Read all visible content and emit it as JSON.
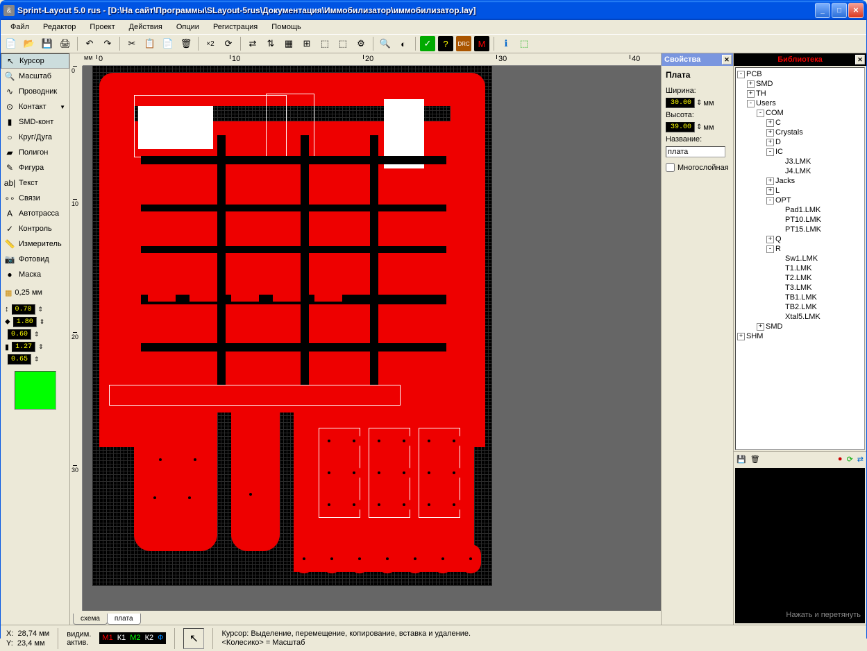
{
  "title": "Sprint-Layout 5.0 rus    - [D:\\На сайт\\Программы\\SLayout-5rus\\Документация\\Иммобилизатор\\иммобилизатор.lay]",
  "menu": [
    "Файл",
    "Редактор",
    "Проект",
    "Действия",
    "Опции",
    "Регистрация",
    "Помощь"
  ],
  "tools": [
    {
      "icon": "↖",
      "label": "Курсор",
      "active": true
    },
    {
      "icon": "🔍",
      "label": "Масштаб"
    },
    {
      "icon": "∿",
      "label": "Проводник"
    },
    {
      "icon": "⊙",
      "label": "Контакт",
      "dd": true
    },
    {
      "icon": "▮",
      "label": "SMD-конт"
    },
    {
      "icon": "○",
      "label": "Круг/Дуга"
    },
    {
      "icon": "▰",
      "label": "Полигон"
    },
    {
      "icon": "✎",
      "label": "Фигура"
    },
    {
      "icon": "ab|",
      "label": "Текст"
    },
    {
      "icon": "∘∘",
      "label": "Связи"
    },
    {
      "icon": "A",
      "label": "Автотрасса"
    },
    {
      "icon": "✓",
      "label": "Контроль"
    },
    {
      "icon": "📏",
      "label": "Измеритель"
    },
    {
      "icon": "📷",
      "label": "Фотовид"
    },
    {
      "icon": "●",
      "label": "Маска"
    }
  ],
  "gridlabel": "0,25 мм",
  "params": [
    {
      "icon": "↕",
      "val": "0.70"
    },
    {
      "icon": "⬥",
      "val": "1.80"
    },
    {
      "icon": "",
      "val": "0.60"
    },
    {
      "icon": "▮",
      "val": "1.27"
    },
    {
      "icon": "",
      "val": "0.65"
    }
  ],
  "hruler": {
    "unit": "мм",
    "ticks": [
      {
        "p": 0,
        "l": "0"
      },
      {
        "p": 192,
        "l": "10"
      },
      {
        "p": 384,
        "l": "20"
      },
      {
        "p": 576,
        "l": "30"
      },
      {
        "p": 768,
        "l": "40"
      }
    ]
  },
  "vruler": {
    "ticks": [
      {
        "p": 0,
        "l": "0"
      },
      {
        "p": 192,
        "l": "10"
      },
      {
        "p": 384,
        "l": "20"
      },
      {
        "p": 576,
        "l": "30"
      }
    ]
  },
  "tabs": [
    {
      "l": "схема"
    },
    {
      "l": "плата",
      "active": true
    }
  ],
  "props": {
    "title": "Свойства",
    "heading": "Плата",
    "width_l": "Ширина:",
    "width_v": "30.00",
    "width_u": "мм",
    "height_l": "Высота:",
    "height_v": "39.00",
    "height_u": "мм",
    "name_l": "Название:",
    "name_v": "плата",
    "multi_l": "Многослойная"
  },
  "lib": {
    "title": "Библиотека",
    "tree": [
      {
        "d": 0,
        "e": "-",
        "l": "PCB"
      },
      {
        "d": 1,
        "e": "+",
        "l": "SMD"
      },
      {
        "d": 1,
        "e": "+",
        "l": "TH"
      },
      {
        "d": 1,
        "e": "-",
        "l": "Users"
      },
      {
        "d": 2,
        "e": "-",
        "l": "COM"
      },
      {
        "d": 3,
        "e": "+",
        "l": "C"
      },
      {
        "d": 3,
        "e": "+",
        "l": "Crystals"
      },
      {
        "d": 3,
        "e": "+",
        "l": "D"
      },
      {
        "d": 3,
        "e": "-",
        "l": "IC"
      },
      {
        "d": 4,
        "e": "",
        "l": "J3.LMK"
      },
      {
        "d": 4,
        "e": "",
        "l": "J4.LMK"
      },
      {
        "d": 3,
        "e": "+",
        "l": "Jacks"
      },
      {
        "d": 3,
        "e": "+",
        "l": "L"
      },
      {
        "d": 3,
        "e": "-",
        "l": "OPT"
      },
      {
        "d": 4,
        "e": "",
        "l": "Pad1.LMK"
      },
      {
        "d": 4,
        "e": "",
        "l": "PT10.LMK"
      },
      {
        "d": 4,
        "e": "",
        "l": "PT15.LMK"
      },
      {
        "d": 3,
        "e": "+",
        "l": "Q"
      },
      {
        "d": 3,
        "e": "-",
        "l": "R"
      },
      {
        "d": 4,
        "e": "",
        "l": "Sw1.LMK"
      },
      {
        "d": 4,
        "e": "",
        "l": "T1.LMK"
      },
      {
        "d": 4,
        "e": "",
        "l": "T2.LMK"
      },
      {
        "d": 4,
        "e": "",
        "l": "T3.LMK"
      },
      {
        "d": 4,
        "e": "",
        "l": "TB1.LMK"
      },
      {
        "d": 4,
        "e": "",
        "l": "TB2.LMK"
      },
      {
        "d": 4,
        "e": "",
        "l": "Xtal5.LMK"
      },
      {
        "d": 2,
        "e": "+",
        "l": "SMD"
      },
      {
        "d": 0,
        "e": "+",
        "l": "SHM"
      }
    ],
    "preview_hint": "Нажать и перетянуть"
  },
  "status": {
    "x_l": "X:",
    "x_v": "28,74 мм",
    "y_l": "Y:",
    "y_v": "23,4 мм",
    "vis_l": "видим.",
    "act_l": "актив.",
    "layers": [
      "М1",
      "К1",
      "М2",
      "К2",
      "Ф"
    ],
    "hint1": "Курсор: Выделение, перемещение, копирование, вставка и удаление.",
    "hint2": "<Колесико> = Масштаб"
  }
}
